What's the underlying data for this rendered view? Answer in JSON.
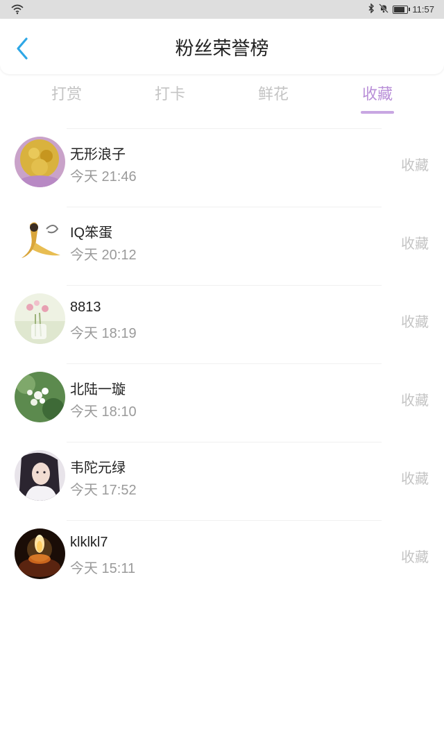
{
  "status_bar": {
    "time": "11:57",
    "icons": [
      "wifi-icon",
      "bluetooth-icon",
      "mute-bell-icon",
      "battery-icon"
    ]
  },
  "header": {
    "title": "粉丝荣誉榜",
    "back_icon": "chevron-left-icon"
  },
  "tabs": [
    {
      "label": "打赏",
      "active": false
    },
    {
      "label": "打卡",
      "active": false
    },
    {
      "label": "鲜花",
      "active": false
    },
    {
      "label": "收藏",
      "active": true
    }
  ],
  "colors": {
    "accent": "#b98fd8",
    "back": "#2ea7e6",
    "muted": "#c4c4c4"
  },
  "fans": [
    {
      "name": "无形浪子",
      "time": "今天 21:46",
      "action": "收藏",
      "avatar": "golden-curly-hair-portrait"
    },
    {
      "name": "IQ笨蛋",
      "time": "今天 20:12",
      "action": "收藏",
      "avatar": "golden-anime-figure"
    },
    {
      "name": "8813",
      "time": "今天 18:19",
      "action": "收藏",
      "avatar": "flowers-vase"
    },
    {
      "name": "北陆一璇",
      "time": "今天 18:10",
      "action": "收藏",
      "avatar": "white-blossoms"
    },
    {
      "name": "韦陀元绿",
      "time": "今天 17:52",
      "action": "收藏",
      "avatar": "girl-portrait"
    },
    {
      "name": "klklkl7",
      "time": "今天 15:11",
      "action": "收藏",
      "avatar": "candle-flame"
    }
  ]
}
